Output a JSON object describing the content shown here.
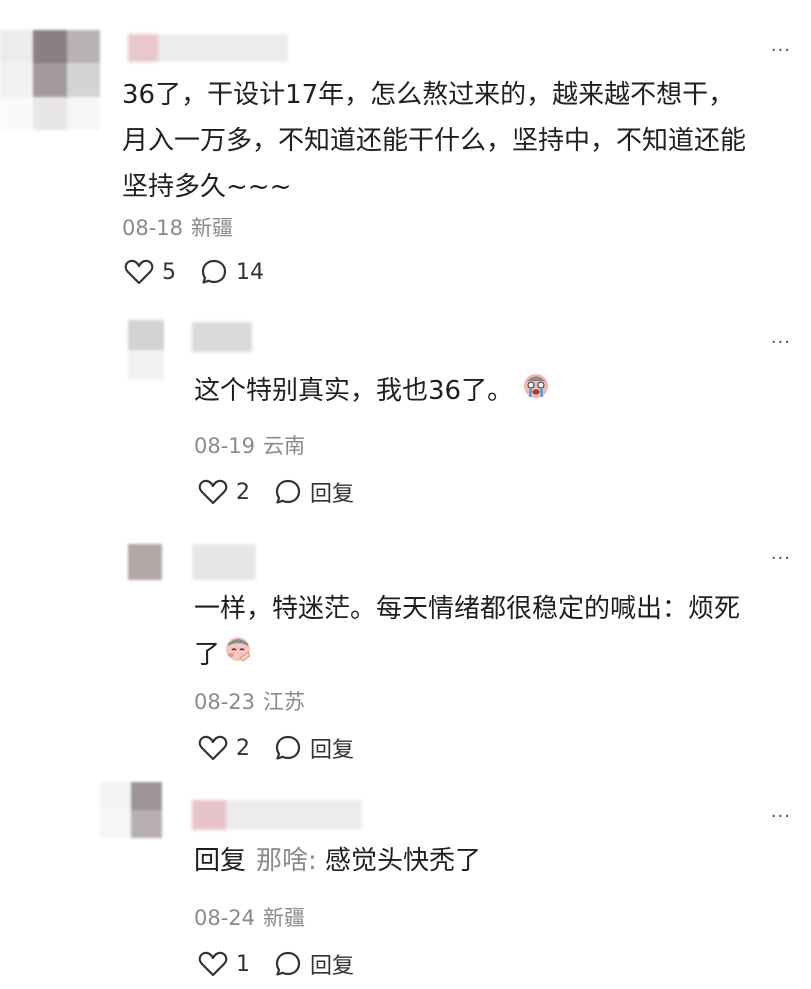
{
  "comments": [
    {
      "text_lines": [
        "36了，干设计17年，怎么熬过来的，越来越不想干，",
        "月入一万多，不知道还能干什么，坚持中，不知道还能",
        "坚持多久~~~"
      ],
      "date": "08-18",
      "location": "新疆",
      "likes": "5",
      "replies": "14"
    },
    {
      "text": "这个特别真实，我也36了。",
      "emoji": "crying-face-emoji",
      "date": "08-19",
      "location": "云南",
      "likes": "2",
      "reply_label": "回复"
    },
    {
      "text_lines": [
        "一样，特迷茫。每天情绪都很稳定的喊出：烦死",
        "了"
      ],
      "emoji": "facepalm-emoji",
      "date": "08-23",
      "location": "江苏",
      "likes": "2",
      "reply_label": "回复"
    },
    {
      "reply_prefix": "回复",
      "reply_target": "那啥:",
      "text": "感觉头快秃了",
      "date": "08-24",
      "location": "新疆",
      "likes": "1",
      "reply_label": "回复"
    }
  ],
  "more_label": "···",
  "colors": {
    "meta": "#8a8a8a",
    "text": "#1f1f1f",
    "icon": "#333333"
  }
}
